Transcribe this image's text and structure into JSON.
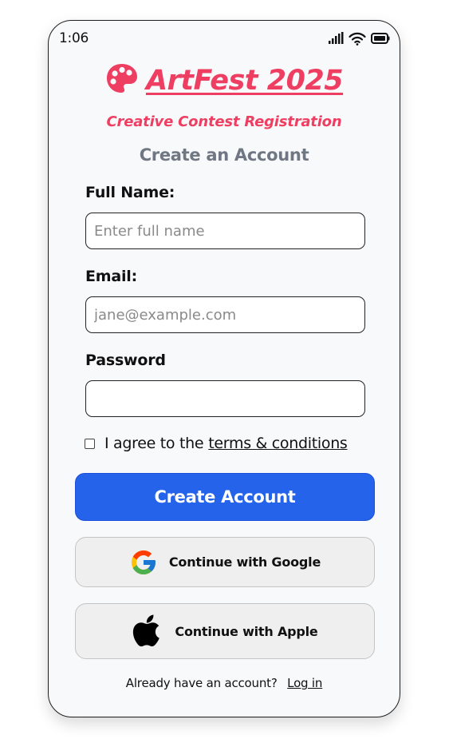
{
  "status_bar": {
    "time": "1:06",
    "icons": [
      "signal-icon",
      "wifi-icon",
      "battery-icon"
    ]
  },
  "header": {
    "title": "ArtFest 2025",
    "title_icon": "palette-icon",
    "subtitle": "Creative Contest Registration",
    "heading": "Create an Account"
  },
  "form": {
    "full_name": {
      "label": "Full Name:",
      "placeholder": "Enter full name",
      "value": ""
    },
    "email": {
      "label": "Email:",
      "placeholder": "jane@example.com",
      "value": ""
    },
    "password": {
      "label": "Password",
      "placeholder": "",
      "value": ""
    },
    "agree": {
      "prefix": "I agree to the",
      "link": "terms & conditions",
      "checked": false
    }
  },
  "buttons": {
    "create_account": "Create Account",
    "google": "Continue with Google",
    "apple": "Continue with Apple"
  },
  "footer": {
    "prompt": "Already have an account?",
    "login_link": "Log in"
  },
  "colors": {
    "accent": "#ee3e62",
    "primary": "#2563eb",
    "heading_gray": "#6f7783",
    "screen_bg": "#f8f9fb"
  }
}
